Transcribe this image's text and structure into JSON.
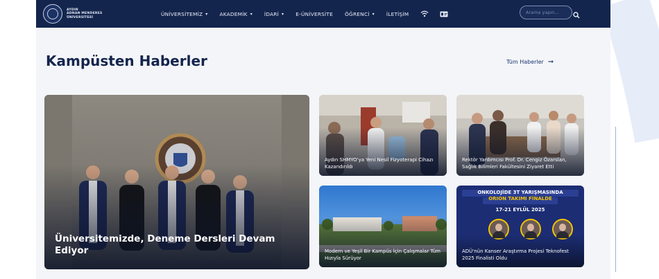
{
  "header": {
    "logo_lines": [
      "AYDIN",
      "ADNAN MENDERES",
      "ÜNİVERSİTESİ"
    ],
    "nav": [
      {
        "label": "ÜNİVERSİTEMİZ",
        "dropdown": true
      },
      {
        "label": "AKADEMİK",
        "dropdown": true
      },
      {
        "label": "İDARİ",
        "dropdown": true
      },
      {
        "label": "E-ÜNİVERSİTE",
        "dropdown": false
      },
      {
        "label": "ÖĞRENCİ",
        "dropdown": true
      },
      {
        "label": "İLETİŞİM",
        "dropdown": false
      }
    ],
    "icons": [
      "wifi-icon",
      "id-card-icon",
      "search-icon"
    ],
    "search_placeholder": "Arama yapın..."
  },
  "section": {
    "title": "Kampüsten Haberler",
    "all_news_label": "Tüm Haberler",
    "all_news_icon": "arrow-right-icon"
  },
  "news": {
    "main": {
      "title": "Üniversitemizde, Deneme Dersleri Devam Ediyor"
    },
    "item_a": {
      "title": "Aydın SHMYO'ya Yeni Nesil Fizyoterapi Cihazı Kazandırıldı"
    },
    "item_b": {
      "title": "Rektör Yardımcısı Prof. Dr. Cengiz Özarslan, Sağlık Bilimleri Fakültesini Ziyaret Etti"
    },
    "item_c": {
      "title": "Modern ve Yeşil Bir Kampüs İçin Çalışmalar Tüm Hızıyla Sürüyor"
    },
    "item_d": {
      "title": "ADÜ'nün Kanser Araştırma Projesi Teknofest 2025 Finalisti Oldu",
      "poster_line1": "ONKOLOJİDE 3T YARIŞMASINDA",
      "poster_line2": "ORION TAKIMI FİNALDE",
      "poster_date": "17-21 EYLÜL 2025"
    }
  },
  "colors": {
    "navbar": "#14254d",
    "accent": "#1a3570",
    "title": "#14254d",
    "page_bg": "#f4f5f8",
    "poster_bg": "#1c2d74",
    "poster_highlight": "#f5c400"
  }
}
